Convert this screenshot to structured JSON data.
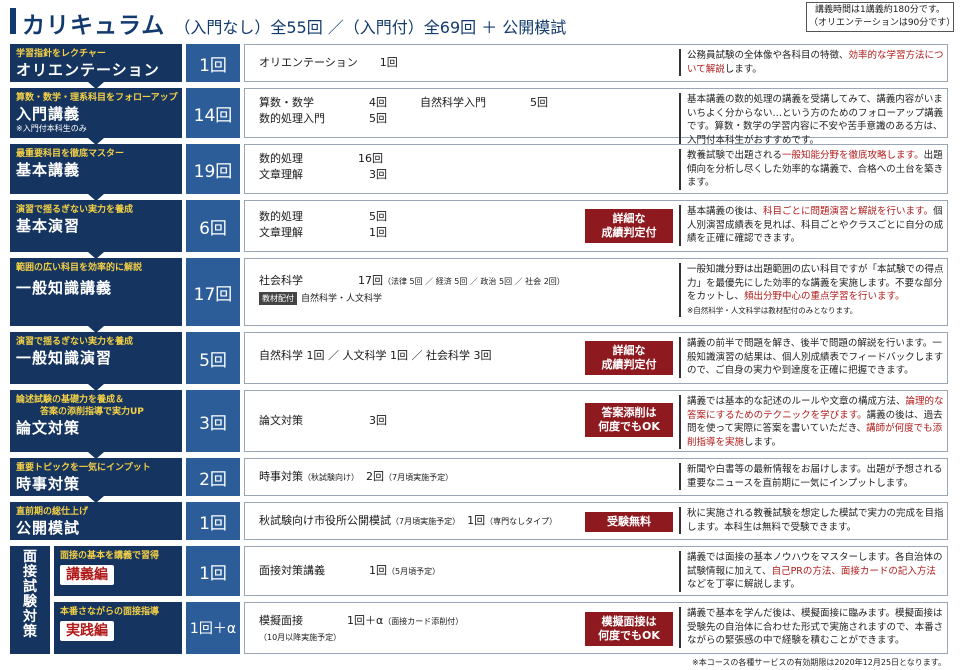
{
  "header": {
    "title": "カリキュラム",
    "subtitle": "（入門なし）全55回 ／（入門付）全69回 ＋ 公開模試",
    "hours_line1": "講義時間は1講義約180分です。",
    "hours_line2": "（オリエンテーションは90分です）"
  },
  "rows": [
    {
      "sub": "学習指針をレクチャー",
      "main": "オリエンテーション",
      "count": "1回",
      "content_lines": [
        "オリエンテーション　　1回"
      ],
      "desc_a": "公務員試験の全体像や各科目の特徴、",
      "desc_red": "効率的な学習方法について解説",
      "desc_b": "します。"
    },
    {
      "sub": "算数・数学・理系科目をフォローアップ",
      "main": "入門講義",
      "note": "※入門付本科生のみ",
      "count": "14回",
      "content_lines": [
        "算数・数学　　　　　4回　　　自然科学入門　　　　5回",
        "数的処理入門　　　　5回"
      ],
      "desc_a": "基本講義の数的処理の講義を受講してみて、講義内容がいまいちよく分からない…という方のためのフォローアップ講義です。算数・数学の学習内容に不安や苦手意識のある方は、入門付本科生がおすすめです。"
    },
    {
      "sub": "最重要科目を徹底マスター",
      "main": "基本講義",
      "count": "19回",
      "content_lines": [
        "数的処理　　　　　16回",
        "文章理解　　　　　　3回"
      ],
      "desc_a": "教養試験で出題される",
      "desc_red": "一般知能分野を徹底攻略します。",
      "desc_b": "出題傾向を分析し尽くした効率的な講義で、合格への土台を築きます。"
    },
    {
      "sub": "演習で揺るぎない実力を養成",
      "main": "基本演習",
      "count": "6回",
      "content_lines": [
        "数的処理　　　　　　5回",
        "文章理解　　　　　　1回"
      ],
      "badge": "詳細な\n成績判定付",
      "desc_a": "基本講義の後は、",
      "desc_red": "科目ごとに問題演習と解説を行います。",
      "desc_b": "個人別演習成績表を見れば、科目ごとやクラスごとに自分の成績を正確に確認できます。"
    },
    {
      "sub": "範囲の広い科目を効率的に解説",
      "main": "一般知識講義",
      "count": "17回",
      "content_line1": "社会科学　　　　　17回",
      "content_line1_small": "（法律 5回 ／ 経済 5回 ／ 政治 5回 ／ 社会 2回）",
      "tag": "教材配付",
      "tag_text": "自然科学・人文科学",
      "desc_a": "一般知識分野は出題範囲の広い科目ですが「本試験での得点力」を最優先にした効率的な講義を実施します。不要な部分をカットし、",
      "desc_red": "頻出分野中心の重点学習を行います。",
      "desc_note": "※自然科学・人文科学は教材配付のみとなります。"
    },
    {
      "sub": "演習で揺るぎない実力を養成",
      "main": "一般知識演習",
      "count": "5回",
      "content_lines": [
        "自然科学 1回 ／ 人文科学 1回 ／ 社会科学 3回"
      ],
      "badge": "詳細な\n成績判定付",
      "desc_a": "講義の前半で問題を解き、後半で問題の解説を行います。一般知識演習の結果は、個人別成績表でフィードバックしますので、ご自身の実力や到達度を正確に把握できます。"
    },
    {
      "sub": "論述試験の基礎力を養成＆",
      "sub2": "答案の添削指導で実力UP",
      "main": "論文対策",
      "count": "3回",
      "content_lines": [
        "論文対策　　　　　　3回"
      ],
      "badge": "答案添削は\n何度でもOK",
      "desc_a": "講義では基本的な記述のルールや文章の構成方法、",
      "desc_red": "論理的な答案にするためのテクニックを学びます。",
      "desc_b": "講義の後は、過去問を使って実際に答案を書いていただき、",
      "desc_red2": "講師が何度でも添削指導を実施",
      "desc_c": "します。"
    },
    {
      "sub": "重要トピックを一気にインプット",
      "main": "時事対策",
      "count": "2回",
      "content_line1": "時事対策",
      "content_line1_small": "（秋試験向け）",
      "content_line1b": "　2回",
      "content_line1b_small": "（7月頃実施予定）",
      "desc_a": "新聞や白書等の最新情報をお届けします。出題が予想される重要なニュースを直前期に一気にインプットします。"
    },
    {
      "sub": "直前期の総仕上げ",
      "main": "公開模試",
      "count": "1回",
      "content_line1": "秋試験向け市役所公開模試",
      "content_line1_small": "（7月頃実施予定）",
      "content_line1b": "　1回",
      "content_line1b_small": "（専門なしタイプ）",
      "badge": "受験無料",
      "desc_a": "秋に実施される教養試験を想定した模試で実力の完成を目指します。本科生は無料で受験できます。"
    }
  ],
  "interview": {
    "side_label": "面接試験対策",
    "rows": [
      {
        "sub": "面接の基本を講義で習得",
        "pill": "講義編",
        "count": "1回",
        "content_line1": "面接対策講義　　　　1回",
        "content_line1_small": "（5月頃予定）",
        "desc_a": "講義では面接の基本ノウハウをマスターします。各自治体の試験情報に加えて、",
        "desc_red": "自己PRの方法、面接カードの記入方法",
        "desc_b": "などを丁寧に解説します。"
      },
      {
        "sub": "本番さながらの面接指導",
        "pill": "実践編",
        "count": "1回＋α",
        "content_line1": "模擬面接　　　　1回＋α",
        "content_line1_small": "（面接カード添削付）",
        "content_line2_small": "（10月以降実施予定）",
        "badge": "模擬面接は\n何度でもOK",
        "desc_a": "講義で基本を学んだ後は、模擬面接に臨みます。模擬面接は受験先の自治体に合わせた形式で実施されますので、本番さながらの緊張感の中で経験を積むことができます。"
      }
    ]
  },
  "footer": "※本コースの各種サービスの有効期限は2020年12月25日となります。"
}
